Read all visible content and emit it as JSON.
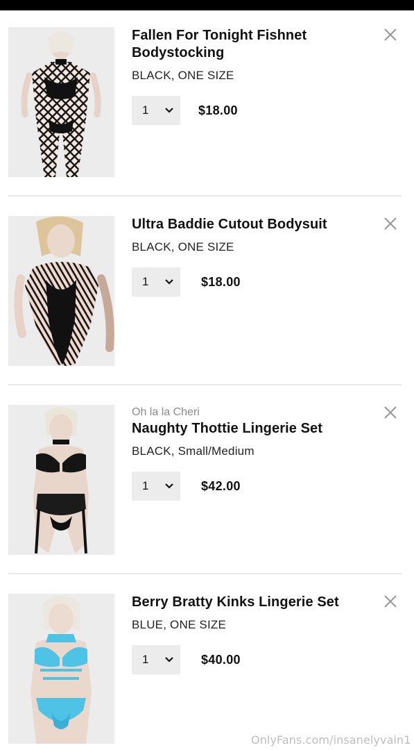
{
  "cart": {
    "items": [
      {
        "brand": "",
        "title": "Fallen For Tonight Fishnet Bodystocking",
        "variant": "BLACK, ONE SIZE",
        "quantity": "1",
        "price": "$18.00",
        "image_icon": "product-photo-bodystocking"
      },
      {
        "brand": "",
        "title": "Ultra Baddie Cutout Bodysuit",
        "variant": "BLACK, ONE SIZE",
        "quantity": "1",
        "price": "$18.00",
        "image_icon": "product-photo-bodysuit"
      },
      {
        "brand": "Oh la la Cheri",
        "title": "Naughty Thottie Lingerie Set",
        "variant": "BLACK, Small/Medium",
        "quantity": "1",
        "price": "$42.00",
        "image_icon": "product-photo-lingerie-set"
      },
      {
        "brand": "",
        "title": "Berry Bratty Kinks Lingerie Set",
        "variant": "BLUE, ONE SIZE",
        "quantity": "1",
        "price": "$40.00",
        "image_icon": "product-photo-lingerie-set"
      }
    ]
  },
  "watermark": "OnlyFans.com/insanelyvain1",
  "colors": {
    "text": "#111111",
    "muted": "#8a8a8a",
    "control_bg": "#ececec",
    "divider": "#e6e6e6",
    "icon_grey": "#9a9a9a",
    "item_black": "#111111",
    "item_blue": "#4fc3e6"
  }
}
